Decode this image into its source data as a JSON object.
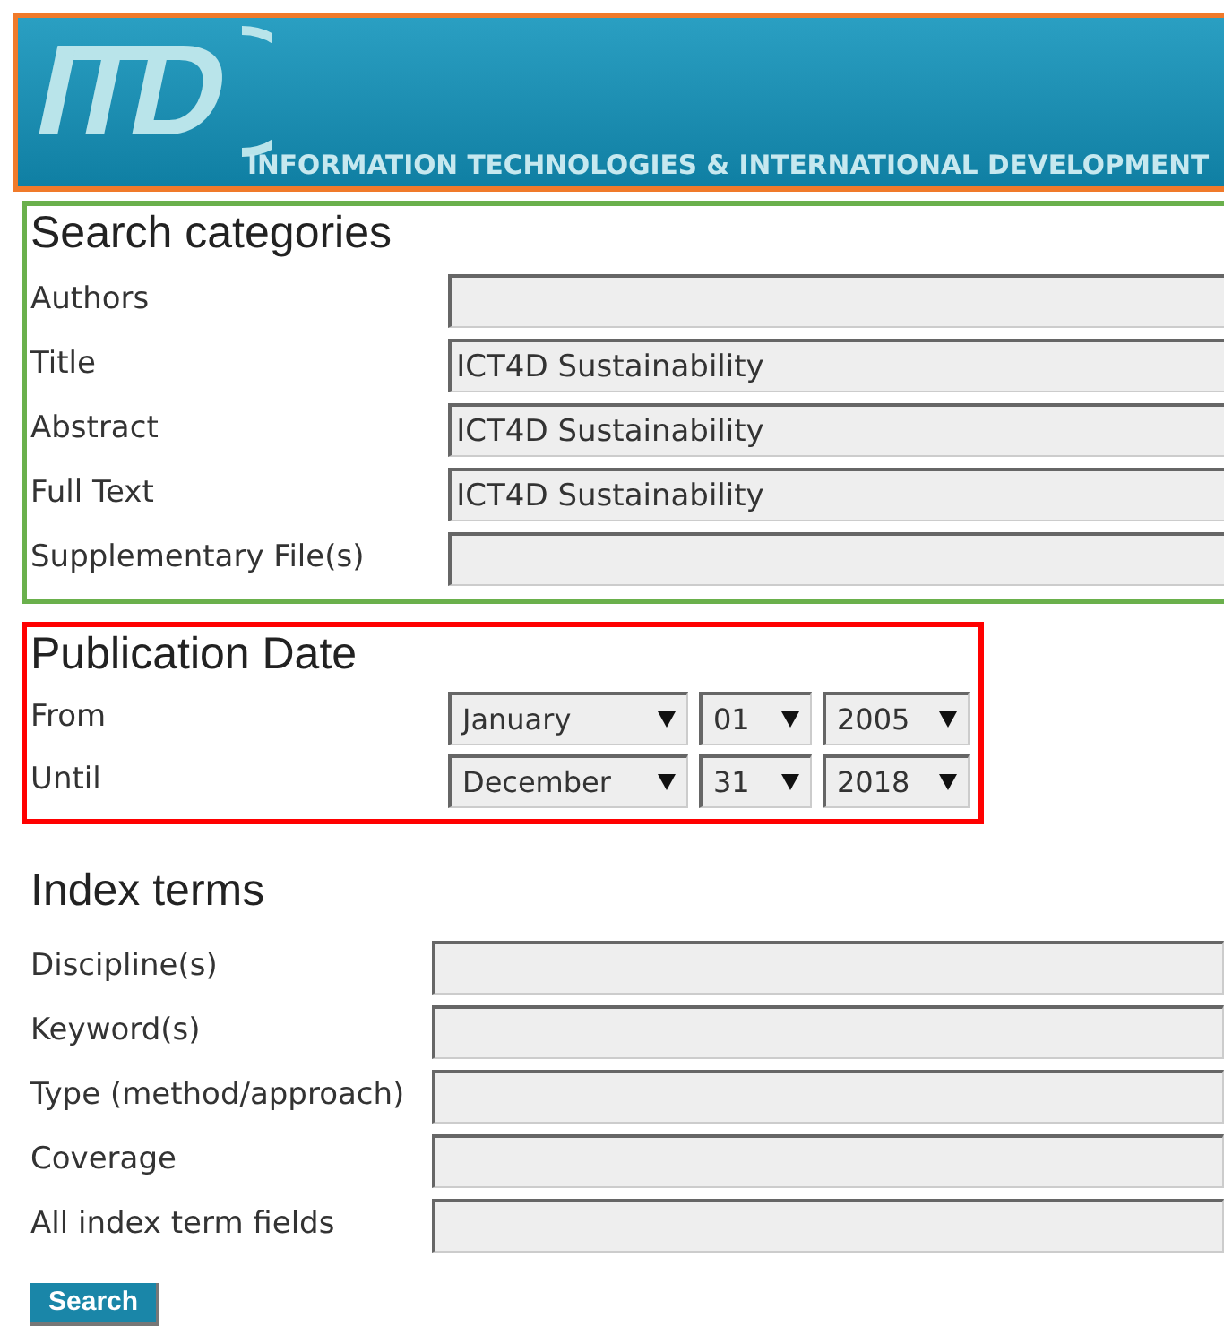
{
  "banner": {
    "logo": "ITD",
    "title": "INFORMATION TECHNOLOGIES & INTERNATIONAL DEVELOPMENT"
  },
  "search_categories": {
    "heading": "Search categories",
    "fields": [
      {
        "label": "Authors"
      },
      {
        "label": "Title",
        "value": "ICT4D Sustainability"
      },
      {
        "label": "Abstract",
        "value": "ICT4D Sustainability"
      },
      {
        "label": "Full Text",
        "value": "ICT4D Sustainability"
      },
      {
        "label": "Supplementary File(s)"
      }
    ]
  },
  "publication_date": {
    "heading": "Publication Date",
    "rows": [
      {
        "label": "From",
        "month": "January",
        "day": "01",
        "year": "2005"
      },
      {
        "label": "Until",
        "month": "December",
        "day": "31",
        "year": "2018"
      }
    ]
  },
  "index_terms": {
    "heading": "Index terms",
    "fields": [
      {
        "label": "Discipline(s)"
      },
      {
        "label": "Keyword(s)"
      },
      {
        "label": "Type (method/approach)"
      },
      {
        "label": "Coverage"
      },
      {
        "label": "All index term fields"
      }
    ]
  },
  "search_button": "Search"
}
